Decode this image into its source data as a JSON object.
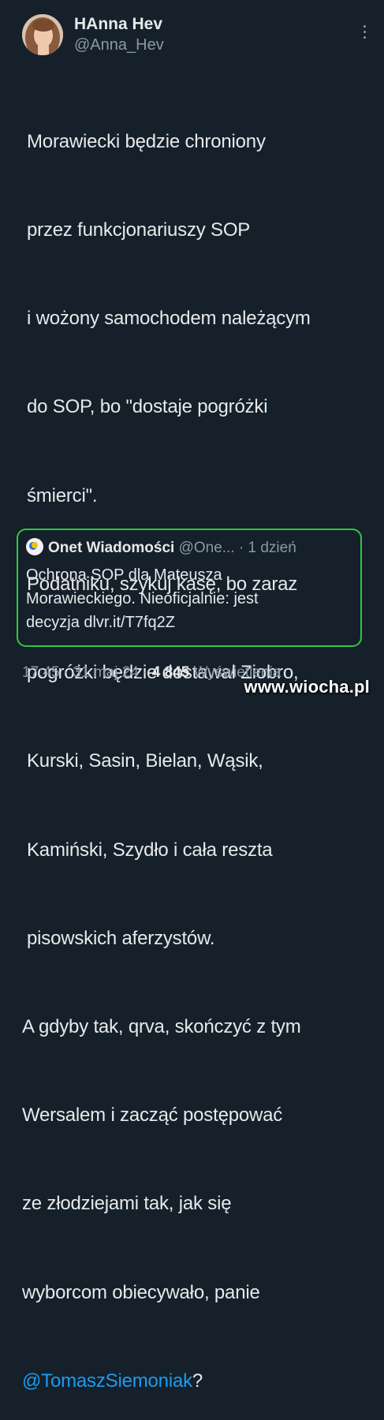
{
  "author": {
    "display_name": "HAnna Hev",
    "handle": "@Anna_Hev"
  },
  "tweet": {
    "lines": [
      "Morawiecki będzie chroniony",
      "przez funkcjonariuszy SOP",
      "i wożony samochodem należącym",
      "do SOP, bo \"dostaje pogróżki",
      "śmierci\".",
      "Podatniku, szykuj kasę, bo zaraz",
      "pogróżki będzie dostawał Ziobro,",
      "Kurski, Sasin, Bielan, Wąsik,",
      "Kamiński, Szydło i cała reszta",
      "pisowskich aferzystów.",
      "A gdyby tak, qrva, skończyć z tym",
      "Wersalem i zacząć postępować",
      "ze złodziejami tak, jak się",
      "wyborcom obiecywało, panie"
    ],
    "mention": "@TomaszSiemoniak",
    "mention_suffix": "?"
  },
  "quote": {
    "name": "Onet Wiadomości",
    "meta": "@One... · 1 dzień",
    "lines": [
      "Ochrona SOP dla Mateusza",
      "Morawieckiego. Nieoficjalnie: jest",
      "decyzja dlvr.it/T7fq2Z"
    ]
  },
  "footer": {
    "time_date": "17:45 · 31 maj 24 · ",
    "views_count": "4 845",
    "views_label": " Wyświetlenia"
  },
  "watermark": "www.wiocha.pl",
  "colors": {
    "background": "#15202b",
    "text": "#e7e9ea",
    "muted": "#8b98a5",
    "link": "#1d9bf0",
    "quote_border": "#2ec93f"
  }
}
